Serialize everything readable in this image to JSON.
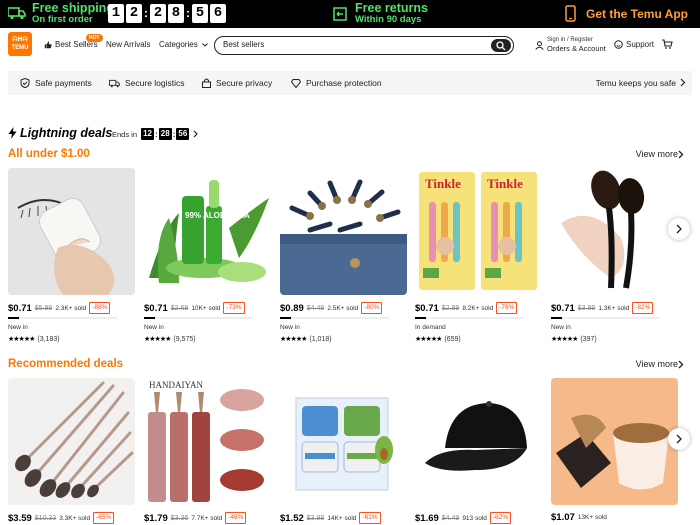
{
  "promo": {
    "shipping_title": "Free shipping",
    "shipping_sub": "On first order",
    "timer_digits": [
      "1",
      "2",
      "2",
      "8",
      "5",
      "6"
    ],
    "returns_title": "Free returns",
    "returns_sub": "Within 90 days",
    "app_label": "Get the Temu App"
  },
  "header": {
    "logo_line1": "ᗩᕼᗩ",
    "logo_line2": "TEMU",
    "best_sellers": "Best Sellers",
    "hot_badge": "HOT",
    "new_arrivals": "New Arrivals",
    "categories": "Categories",
    "search_value": "Best sellers",
    "signin_line1": "Sign in / Register",
    "signin_line2": "Orders & Account",
    "support": "Support"
  },
  "trust": {
    "items": [
      "Safe payments",
      "Secure logistics",
      "Secure privacy",
      "Purchase protection"
    ],
    "right": "Temu keeps you safe"
  },
  "lightning": {
    "title": "Lightning deals",
    "ends_in": "Ends in",
    "hh": "12",
    "mm": "28",
    "ss": "56"
  },
  "section1": {
    "title": "All under $1.00",
    "view_more": "View more",
    "products": [
      {
        "price": "$0.71",
        "orig": "$5.99",
        "sold": "2.3K+ sold",
        "disc": "-88%",
        "tag": "New in",
        "reviews": "(3,183)",
        "progress": 0.1
      },
      {
        "price": "$0.71",
        "orig": "$2.69",
        "sold": "10K+ sold",
        "disc": "-73%",
        "tag": "New in",
        "reviews": "(9,575)",
        "progress": 0.1
      },
      {
        "price": "$0.89",
        "orig": "$4.49",
        "sold": "2.5K+ sold",
        "disc": "-80%",
        "tag": "New in",
        "reviews": "(1,018)",
        "progress": 0.1
      },
      {
        "price": "$0.71",
        "orig": "$2.99",
        "sold": "8.2K+ sold",
        "disc": "-76%",
        "tag": "In demand",
        "reviews": "(659)",
        "progress": 0.1
      },
      {
        "price": "$0.71",
        "orig": "$3.99",
        "sold": "1.3K+ sold",
        "disc": "-82%",
        "tag": "New in",
        "reviews": "(397)",
        "progress": 0.1
      }
    ]
  },
  "section2": {
    "title": "Recommended deals",
    "view_more": "View more",
    "products": [
      {
        "price": "$3.59",
        "orig": "$10.33",
        "sold": "3.3K+ sold",
        "disc": "-65%"
      },
      {
        "price": "$1.79",
        "orig": "$3.36",
        "sold": "7.7K+ sold",
        "disc": "-46%"
      },
      {
        "price": "$1.52",
        "orig": "$3.98",
        "sold": "14K+ sold",
        "disc": "-61%"
      },
      {
        "price": "$1.69",
        "orig": "$4.49",
        "sold": "913 sold",
        "disc": "-62%"
      },
      {
        "price": "$1.07",
        "orig": "",
        "sold": "13K+ sold",
        "disc": ""
      }
    ]
  },
  "image_text": {
    "tinkle": "Tinkle",
    "handaiyan": "HANDAIYAN",
    "aloe": "99% ALOE VERA"
  },
  "colors": {
    "brand_orange": "#fb7701",
    "promo_green": "#52e06a",
    "discount_red": "#fb4e1e"
  }
}
